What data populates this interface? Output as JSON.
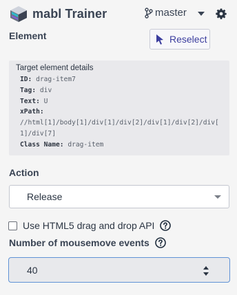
{
  "header": {
    "app_title": "mabl Trainer",
    "branch": "master",
    "icons": {
      "logo": "mabl-logo-icon",
      "branch": "git-branch-icon",
      "caret": "chevron-down-icon",
      "settings": "gear-icon"
    }
  },
  "element_section": {
    "label": "Element",
    "reselect_label": "Reselect"
  },
  "target_details": {
    "title": "Target element details",
    "rows": [
      {
        "key": "ID:",
        "value": "drag-item7"
      },
      {
        "key": "Tag:",
        "value": "div"
      },
      {
        "key": "Text:",
        "value": "U"
      },
      {
        "key": "xPath:",
        "value": ""
      },
      {
        "key": "",
        "value": "//html[1]/body[1]/div[1]/div[2]/div[1]/div[2]/div["
      },
      {
        "key": "",
        "value": "1]/div[7]"
      },
      {
        "key": "Class Name:",
        "value": "drag-item"
      }
    ]
  },
  "action": {
    "label": "Action",
    "selected": "Release"
  },
  "html5_checkbox": {
    "label": "Use HTML5 drag and drop API",
    "checked": false
  },
  "mousemove": {
    "label": "Number of mousemove events",
    "value": "40"
  },
  "colors": {
    "accent": "#3b3d9e",
    "focus_border": "#5f92d6",
    "background": "#f5f5f5",
    "details_bg": "#e9e9ec"
  }
}
